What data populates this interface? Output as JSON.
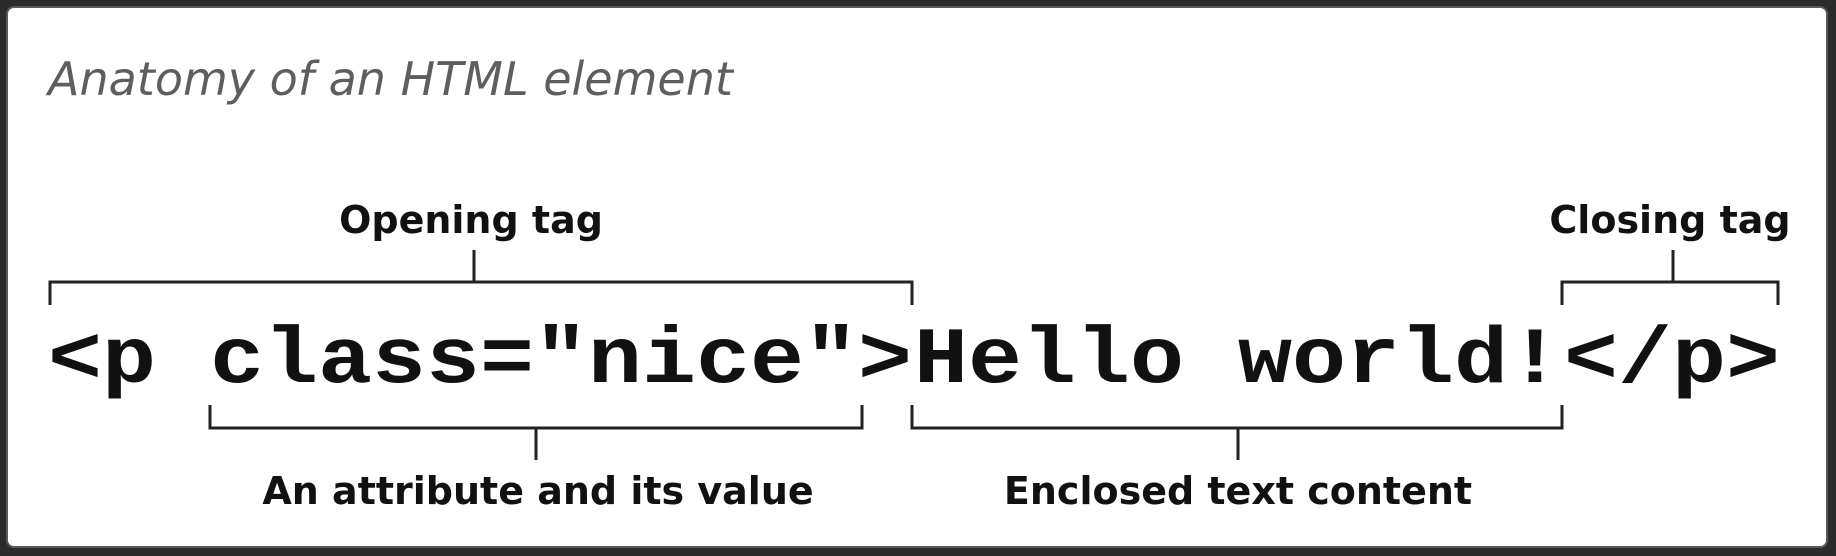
{
  "title": "Anatomy of an HTML element",
  "code": {
    "opening_tag": "<p class=\"nice\">",
    "content": "Hello world!",
    "closing_tag": "</p>"
  },
  "labels": {
    "opening_tag": "Opening tag",
    "closing_tag": "Closing tag",
    "attribute": "An attribute and its value",
    "content": "Enclosed text content"
  }
}
